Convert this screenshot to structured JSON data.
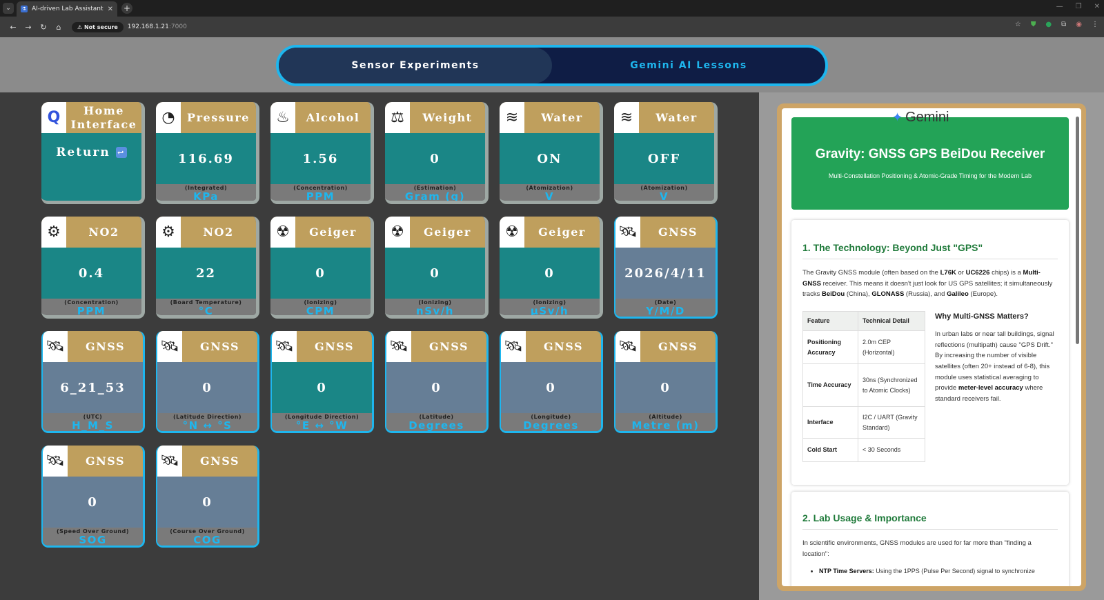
{
  "browser": {
    "tab_title": "AI-driven Lab Assistant",
    "tab_favicon": "lab-icon",
    "not_secure": "Not secure",
    "url_host": "192.168.1.21",
    "url_port": ":7000"
  },
  "nav": {
    "tabs": [
      {
        "label": "Sensor Experiments",
        "active": true
      },
      {
        "label": "Gemini AI Lessons",
        "active": false
      }
    ]
  },
  "cards": [
    {
      "title": "Home Interface",
      "value": "Return",
      "sub": "",
      "unit": "",
      "icon": "qualcomm-logo-icon",
      "body": "teal",
      "border": "plain"
    },
    {
      "title": "Pressure",
      "value": "116.69",
      "sub": "(Integrated)",
      "unit": "KPa",
      "icon": "pressure-gauge-icon",
      "body": "teal",
      "border": "plain"
    },
    {
      "title": "Alcohol",
      "value": "1.56",
      "sub": "(Concentration)",
      "unit": "PPM",
      "icon": "alcohol-burner-icon",
      "body": "teal",
      "border": "plain"
    },
    {
      "title": "Weight",
      "value": "0",
      "sub": "(Estimation)",
      "unit": "Gram (g)",
      "icon": "scale-icon",
      "body": "teal",
      "border": "plain"
    },
    {
      "title": "Water",
      "value": "ON",
      "sub": "(Atomization)",
      "unit": "V",
      "icon": "steam-icon",
      "body": "teal",
      "border": "plain"
    },
    {
      "title": "Water",
      "value": "OFF",
      "sub": "(Atomization)",
      "unit": "V",
      "icon": "steam-icon",
      "body": "teal",
      "border": "plain"
    },
    {
      "title": "NO2",
      "value": "0.4",
      "sub": "(Concentration)",
      "unit": "PPM",
      "icon": "no2-gear-icon",
      "body": "teal",
      "border": "plain"
    },
    {
      "title": "NO2",
      "value": "22",
      "sub": "(Board Temperature)",
      "unit": "°C",
      "icon": "no2-gear-icon",
      "body": "teal",
      "border": "plain"
    },
    {
      "title": "Geiger",
      "value": "0",
      "sub": "(Ionizing)",
      "unit": "CPM",
      "icon": "geiger-counter-icon",
      "body": "teal",
      "border": "plain"
    },
    {
      "title": "Geiger",
      "value": "0",
      "sub": "(Ionizing)",
      "unit": "nSv/h",
      "icon": "geiger-counter-icon",
      "body": "teal",
      "border": "plain"
    },
    {
      "title": "Geiger",
      "value": "0",
      "sub": "(Ionizing)",
      "unit": "μSv/h",
      "icon": "geiger-counter-icon",
      "body": "teal",
      "border": "plain"
    },
    {
      "title": "GNSS",
      "value": "2026/4/11",
      "sub": "(Date)",
      "unit": "Y/M/D",
      "icon": "satellite-icon",
      "body": "slate",
      "border": "blue"
    },
    {
      "title": "GNSS",
      "value": "6_21_53",
      "sub": "(UTC)",
      "unit": "H_M_S",
      "icon": "satellite-icon",
      "body": "slate",
      "border": "blue"
    },
    {
      "title": "GNSS",
      "value": "0",
      "sub": "(Latitude Direction)",
      "unit": "°N ↔ °S",
      "icon": "satellite-icon",
      "body": "slate",
      "border": "blue"
    },
    {
      "title": "GNSS",
      "value": "0",
      "sub": "(Longitude Direction)",
      "unit": "°E ↔ °W",
      "icon": "satellite-icon",
      "body": "teal",
      "border": "blue"
    },
    {
      "title": "GNSS",
      "value": "0",
      "sub": "(Latitude)",
      "unit": "Degrees",
      "icon": "satellite-icon",
      "body": "slate",
      "border": "blue"
    },
    {
      "title": "GNSS",
      "value": "0",
      "sub": "(Longitude)",
      "unit": "Degrees",
      "icon": "satellite-icon",
      "body": "slate",
      "border": "blue"
    },
    {
      "title": "GNSS",
      "value": "0",
      "sub": "(Altitude)",
      "unit": "Metre (m)",
      "icon": "satellite-icon",
      "body": "slate",
      "border": "blue"
    },
    {
      "title": "GNSS",
      "value": "0",
      "sub": "(Speed Over Ground)",
      "unit": "SOG",
      "icon": "satellite-icon",
      "body": "slate",
      "border": "blue"
    },
    {
      "title": "GNSS",
      "value": "0",
      "sub": "(Course Over Ground)",
      "unit": "COG",
      "icon": "satellite-icon",
      "body": "slate",
      "border": "blue"
    }
  ],
  "lesson": {
    "brand": "Gemini",
    "title": "Gravity: GNSS GPS BeiDou Receiver",
    "subtitle": "Multi-Constellation Positioning & Atomic-Grade Timing for the Modern Lab",
    "section1": {
      "heading": "1. The Technology: Beyond Just \"GPS\"",
      "intro": [
        "The Gravity GNSS module (often based on the ",
        "L76K",
        " or ",
        "UC6226",
        " chips) is a ",
        "Multi-GNSS",
        " receiver. This means it doesn't just look for US GPS satellites; it simultaneously tracks ",
        "BeiDou",
        " (China), ",
        "GLONASS",
        " (Russia), and ",
        "Galileo",
        " (Europe)."
      ],
      "table_headers": [
        "Feature",
        "Technical Detail"
      ],
      "table_rows": [
        [
          "Positioning Accuracy",
          "2.0m CEP (Horizontal)"
        ],
        [
          "Time Accuracy",
          "30ns (Synchronized to Atomic Clocks)"
        ],
        [
          "Interface",
          "I2C / UART (Gravity Standard)"
        ],
        [
          "Cold Start",
          "< 30 Seconds"
        ]
      ],
      "why_heading": "Why Multi-GNSS Matters?",
      "why_text": [
        "In urban labs or near tall buildings, signal reflections (multipath) cause \"GPS Drift.\" By increasing the number of visible satellites (often 20+ instead of 6-8), this module uses statistical averaging to provide ",
        "meter-level accuracy",
        " where standard receivers fail."
      ]
    },
    "section2": {
      "heading": "2. Lab Usage & Importance",
      "intro": "In scientific environments, GNSS modules are used for far more than \"finding a location\":",
      "bullet_bold": "NTP Time Servers:",
      "bullet_text": " Using the 1PPS (Pulse Per Second) signal to synchronize"
    }
  },
  "colors": {
    "accent": "#1eb6ee",
    "card_header": "#bf9f5d",
    "teal": "#1a8686",
    "slate": "#667e96",
    "gemini_green": "#23a357"
  }
}
